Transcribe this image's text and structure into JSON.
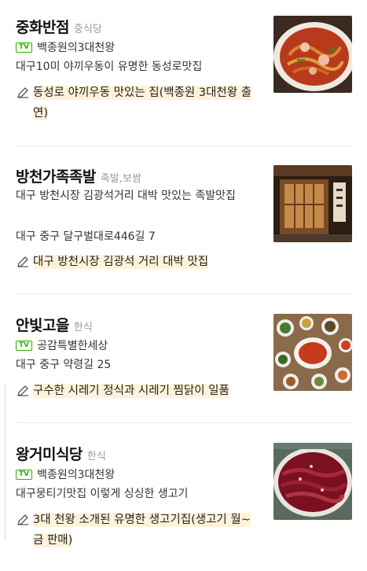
{
  "restaurants": [
    {
      "name": "중화반점",
      "category": "중식당",
      "tv_label": "TV",
      "tv_show": "백종원의3대천왕",
      "lines": [
        "대구10미 야끼우동이 유명한 동성로맛집"
      ],
      "review": "동성로 야끼우동 맛있는 집(백종원 3대천왕 출연)",
      "photo_icon": "noodle-dish-photo"
    },
    {
      "name": "방천가족족발",
      "category": "족발,보쌈",
      "lines": [
        "대구 방천시장 김광석거리 대박 맛있는 족발맛집",
        "대구 중구 달구벌대로446길 7"
      ],
      "review": "대구 방천시장 김광석 거리 대박 맛집",
      "photo_icon": "storefront-photo"
    },
    {
      "name": "안빛고을",
      "category": "한식",
      "tv_label": "TV",
      "tv_show": "공감특별한세상",
      "lines": [
        "대구 중구 약령길 25"
      ],
      "review": "구수한 시레기 정식과 시레기 찜닭이 일품",
      "photo_icon": "korean-table-photo"
    },
    {
      "name": "왕거미식당",
      "category": "한식",
      "tv_label": "TV",
      "tv_show": "백종원의3대천왕",
      "lines": [
        "대구뭉티기맛집 이렇게 싱싱한 생고기"
      ],
      "review": "3대 천왕 소개된 유명한 생고기집(생고기 월~금 판매)",
      "photo_icon": "raw-beef-photo"
    }
  ],
  "colors": {
    "tv_badge": "#2db400",
    "highlight": "#fff2d9",
    "category": "#999999"
  }
}
